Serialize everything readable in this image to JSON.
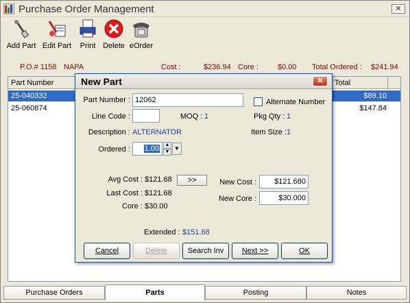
{
  "window": {
    "title": "Purchase Order Management",
    "close_glyph": "✕"
  },
  "toolbar": {
    "add_part": "Add Part",
    "edit_part": "Edit Part",
    "print": "Print",
    "delete": "Delete",
    "eorder": "eOrder"
  },
  "summary": {
    "po": "P.O.# 1158",
    "vendor": "NAPA",
    "cost_label": "Cost :",
    "cost": "$236.94",
    "core_label": "Core :",
    "core": "$0.00",
    "total_label": "Total Ordered :",
    "total": "$241.94"
  },
  "grid": {
    "headers": {
      "part_number": "Part Number",
      "total": "Total"
    },
    "rows": [
      {
        "part": "25-040332",
        "total": "$89.10"
      },
      {
        "part": "25-060874",
        "total": "$147.84"
      }
    ]
  },
  "tabs": [
    "Purchase Orders",
    "Parts",
    "Posting",
    "Notes"
  ],
  "dialog": {
    "title": "New Part",
    "close_glyph": "✕",
    "part_number_label": "Part Number :",
    "part_number": "12062",
    "alternate_label": "Alternate Number",
    "line_code_label": "Line Code :",
    "line_code": "",
    "moq_label": "MOQ :",
    "moq": "1",
    "pkg_qty_label": "Pkg Qty :",
    "pkg_qty": "1",
    "description_label": "Description :",
    "description": "ALTERNATOR",
    "item_size_label": "Item Size :",
    "item_size": "1",
    "ordered_label": "Ordered :",
    "ordered": "1.00",
    "avg_cost_label": "Avg Cost :",
    "avg_cost": "$121.68",
    "last_cost_label": "Last Cost :",
    "last_cost": "$121.68",
    "core_label": "Core :",
    "core": "$30.00",
    "transfer_button": ">>",
    "new_cost_label": "New Cost :",
    "new_cost": "$121.680",
    "new_core_label": "New Core :",
    "new_core": "$30.000",
    "extended_label": "Extended :",
    "extended": "$151.68",
    "buttons": {
      "cancel": "Cancel",
      "delete": "Delete",
      "search_inv": "Search Inv",
      "next": "Next >>",
      "ok": "OK"
    }
  }
}
